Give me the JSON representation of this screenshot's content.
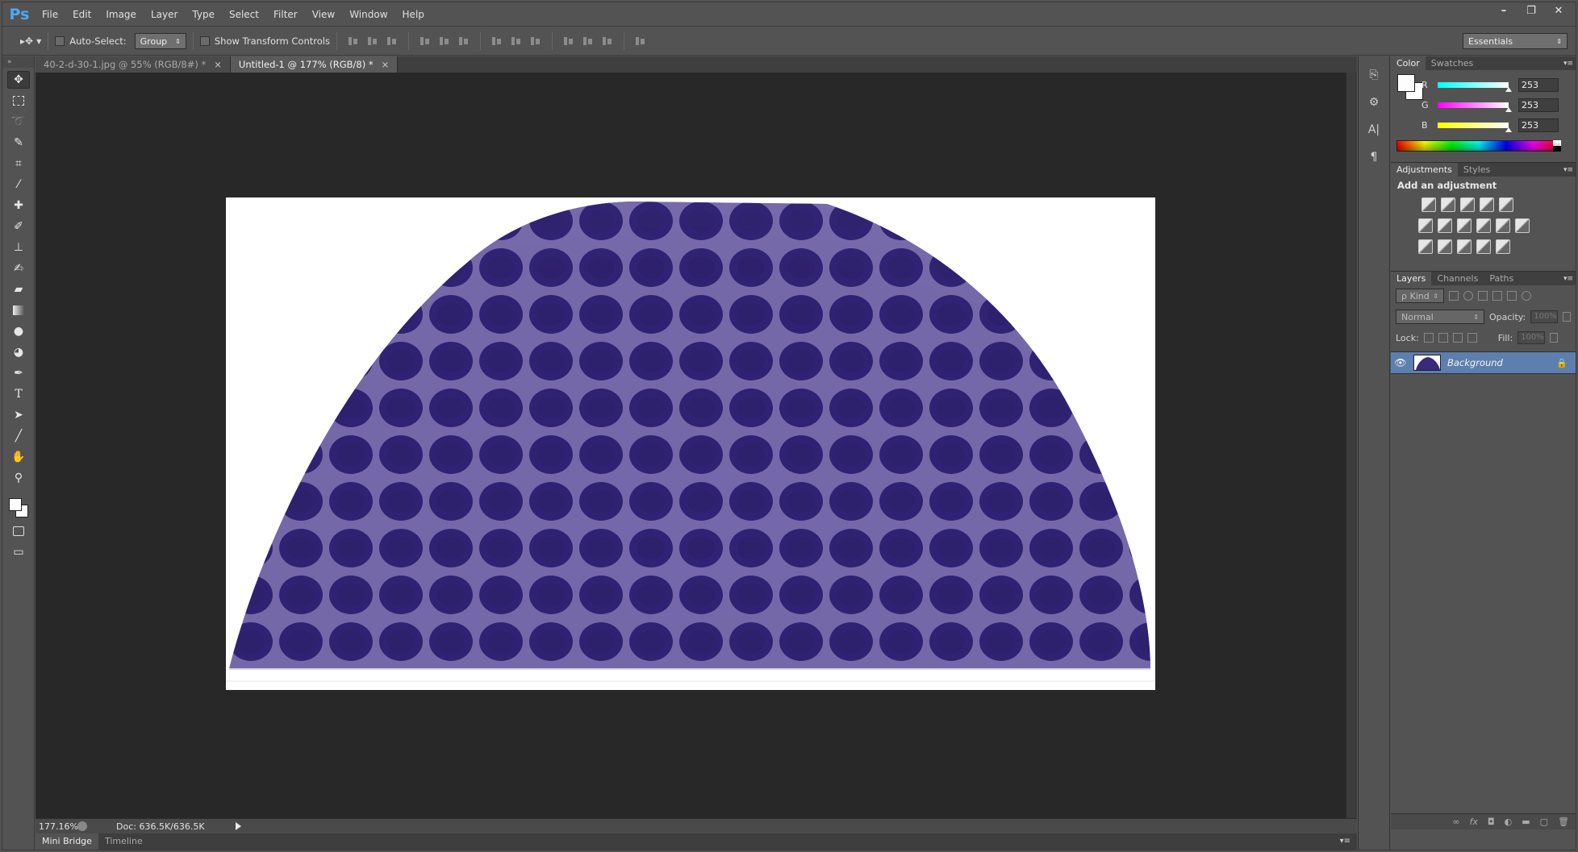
{
  "app": {
    "logo": "Ps",
    "menu": [
      "File",
      "Edit",
      "Image",
      "Layer",
      "Type",
      "Select",
      "Filter",
      "View",
      "Window",
      "Help"
    ],
    "window_controls": [
      "–",
      "❐",
      "✕"
    ]
  },
  "options": {
    "auto_select_label": "Auto-Select:",
    "auto_select_value": "Group",
    "show_transform_label": "Show Transform Controls",
    "workspace": "Essentials"
  },
  "tabs": [
    {
      "label": "40-2-d-30-1.jpg @ 55% (RGB/8#) *",
      "close": "×"
    },
    {
      "label": "Untitled-1 @ 177% (RGB/8) *",
      "close": "×"
    }
  ],
  "status": {
    "zoom": "177.16%",
    "doc": "Doc: 636.5K/636.5K"
  },
  "bottom_tabs": [
    "Mini Bridge",
    "Timeline"
  ],
  "panels": {
    "color": {
      "tabs": [
        "Color",
        "Swatches"
      ],
      "r_label": "R",
      "g_label": "G",
      "b_label": "B",
      "r": "253",
      "g": "253",
      "b": "253"
    },
    "adjustments": {
      "tabs": [
        "Adjustments",
        "Styles"
      ],
      "title": "Add an adjustment"
    },
    "layers": {
      "tabs": [
        "Layers",
        "Channels",
        "Paths"
      ],
      "kind": "ρ Kind",
      "blend_mode": "Normal",
      "opacity_label": "Opacity:",
      "opacity_value": "100%",
      "lock_label": "Lock:",
      "fill_label": "Fill:",
      "fill_value": "100%",
      "layer_name": "Background"
    }
  },
  "colors": {
    "canvas_bg": "#282828",
    "ui_bg": "#535353",
    "layer_selected": "#5c7fae",
    "tissue_purple": "#3a2a7a"
  }
}
